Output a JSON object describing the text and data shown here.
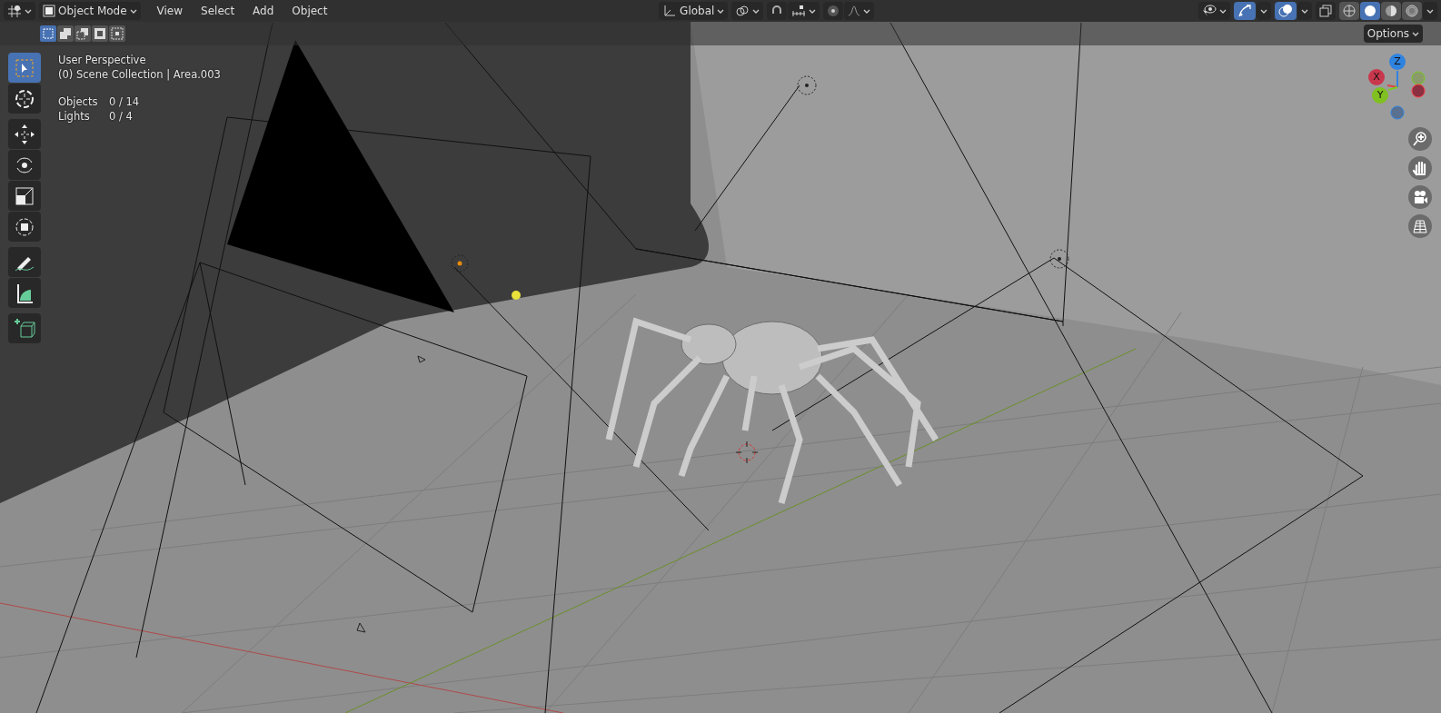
{
  "header": {
    "mode": "Object Mode",
    "menus": [
      "View",
      "Select",
      "Add",
      "Object"
    ],
    "orientation": "Global",
    "snap": {
      "on": false
    },
    "proportional": {
      "on": false
    },
    "overlays": {
      "on": true
    },
    "gizmos": {
      "on": true
    },
    "xray": {
      "on": false
    },
    "shading": [
      {
        "kind": "wireframe",
        "selected": false
      },
      {
        "kind": "solid",
        "selected": true
      },
      {
        "kind": "material",
        "selected": false
      },
      {
        "kind": "rendered",
        "selected": false
      }
    ]
  },
  "select_modes": [
    {
      "kind": "set",
      "selected": true
    },
    {
      "kind": "extend",
      "selected": false
    },
    {
      "kind": "subtract",
      "selected": false
    },
    {
      "kind": "invert",
      "selected": false
    },
    {
      "kind": "intersect",
      "selected": false
    }
  ],
  "options": "Options",
  "info": {
    "view": "User Perspective",
    "collection": "(0) Scene Collection | Area.003",
    "stats": [
      {
        "label": "Objects",
        "value": "0 / 14"
      },
      {
        "label": "Lights",
        "value": "0 / 4"
      }
    ]
  },
  "tool_groups": [
    {
      "tools": [
        {
          "kind": "select",
          "selected": true
        },
        {
          "kind": "cursor",
          "selected": false
        }
      ]
    },
    {
      "tools": [
        {
          "kind": "move",
          "selected": false
        },
        {
          "kind": "rotate",
          "selected": false
        },
        {
          "kind": "scale",
          "selected": false
        },
        {
          "kind": "transform",
          "selected": false
        }
      ]
    },
    {
      "tools": [
        {
          "kind": "annotate",
          "selected": false
        },
        {
          "kind": "measure",
          "selected": false
        }
      ]
    },
    {
      "tools": [
        {
          "kind": "add_cube",
          "selected": false
        }
      ]
    }
  ],
  "gizmo": {
    "axes": [
      {
        "kind": "z",
        "label": "Z"
      },
      {
        "kind": "x",
        "label": "X"
      },
      {
        "kind": "y",
        "label": "Y"
      }
    ]
  }
}
